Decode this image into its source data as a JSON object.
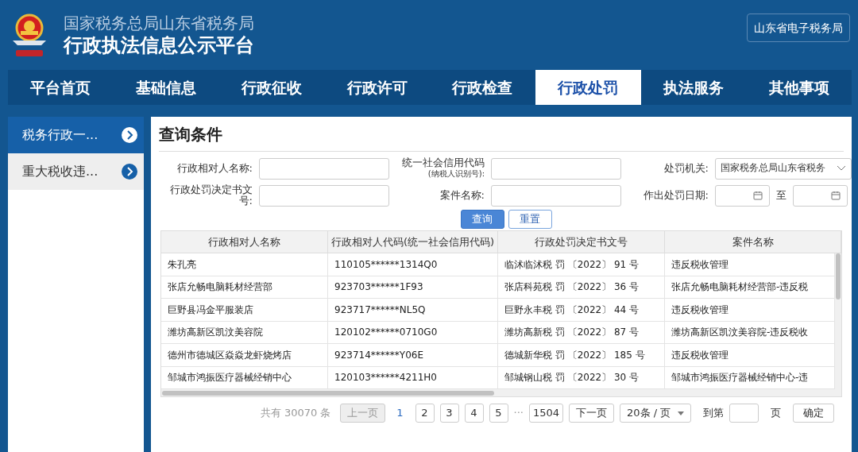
{
  "header": {
    "subtitle": "国家税务总局山东省税务局",
    "title": "行政执法信息公示平台",
    "link": "山东省电子税务局"
  },
  "nav": [
    {
      "label": "平台首页",
      "selected": false
    },
    {
      "label": "基础信息",
      "selected": false
    },
    {
      "label": "行政征收",
      "selected": false
    },
    {
      "label": "行政许可",
      "selected": false
    },
    {
      "label": "行政检查",
      "selected": false
    },
    {
      "label": "行政处罚",
      "selected": true
    },
    {
      "label": "执法服务",
      "selected": false
    },
    {
      "label": "其他事项",
      "selected": false
    }
  ],
  "sidebar": {
    "items": [
      {
        "label": "税务行政一...",
        "selected": true
      },
      {
        "label": "重大税收违...",
        "selected": false
      }
    ]
  },
  "query": {
    "title": "查询条件",
    "fields": [
      {
        "kind": "text",
        "label": "行政相对人名称:"
      },
      {
        "kind": "text",
        "label": "统一社会信用代码",
        "sublabel": "(纳税人识别号):"
      },
      {
        "kind": "select",
        "label": "处罚机关:",
        "value": "国家税务总局山东省税务"
      },
      {
        "kind": "text",
        "label": "行政处罚决定书文号:"
      },
      {
        "kind": "text",
        "label": "案件名称:"
      },
      {
        "kind": "daterange",
        "label": "作出处罚日期:",
        "separator": "至"
      }
    ],
    "buttons": [
      {
        "label": "查询",
        "kind": "primary"
      },
      {
        "label": "重置",
        "kind": "secondary"
      }
    ]
  },
  "table": {
    "columns": [
      "行政相对人名称",
      "行政相对人代码(统一社会信用代码)",
      "行政处罚决定书文号",
      "案件名称"
    ],
    "rows": [
      [
        "朱孔亮",
        "110105******1314Q0",
        "临沭临沭税 罚 〔2022〕 91 号",
        "违反税收管理"
      ],
      [
        "张店允畅电脑耗材经营部",
        "923703******1F93",
        "张店科苑税 罚 〔2022〕 36 号",
        "张店允畅电脑耗材经营部-违反税"
      ],
      [
        "巨野县冯金平服装店",
        "923717******NL5Q",
        "巨野永丰税  罚 〔2022〕 44 号",
        "违反税收管理"
      ],
      [
        "潍坊高新区凯汶美容院",
        "120102******0710G0",
        "潍坊高新税 罚 〔2022〕 87 号",
        "潍坊高新区凯汶美容院-违反税收"
      ],
      [
        "德州市德城区焱焱龙虾烧烤店",
        "923714******Y06E",
        "德城新华税 罚 〔2022〕 185 号",
        "违反税收管理"
      ],
      [
        "邹城市鸿振医疗器械经销中心",
        "120103******4211H0",
        "邹城钢山税 罚 〔2022〕 30 号",
        "邹城市鸿振医疗器械经销中心-违"
      ]
    ]
  },
  "pagination": {
    "total": "共有 30070 条",
    "prev": "上一页",
    "pages": [
      {
        "label": "1",
        "selected": true
      },
      {
        "label": "2",
        "selected": false
      },
      {
        "label": "3",
        "selected": false
      },
      {
        "label": "4",
        "selected": false
      },
      {
        "label": "5",
        "selected": false
      }
    ],
    "ellipsis": "···",
    "last": "1504",
    "next": "下一页",
    "page_size": "20条 / 页",
    "goto": "到第",
    "page_unit": "页",
    "confirm": "确定"
  }
}
